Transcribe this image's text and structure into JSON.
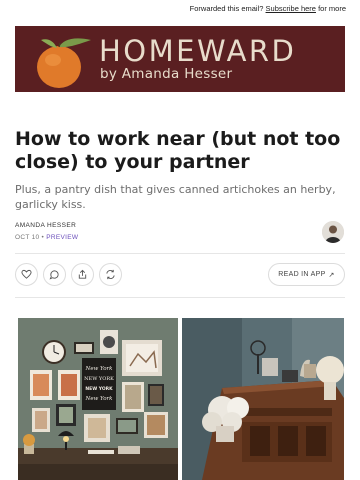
{
  "topbar": {
    "prefix": "Forwarded this email? ",
    "link_label": "Subscribe here",
    "suffix": " for more"
  },
  "banner": {
    "brand": "HOMEWARD",
    "byline": "by Amanda Hesser",
    "colors": {
      "background": "#5a1f21",
      "text": "#e8dccb",
      "orange": "#e07a2a",
      "leaf": "#7a9a4a"
    }
  },
  "post": {
    "title": "How to work near (but not too close) to your partner",
    "subtitle": "Plus, a pantry dish that gives canned artichokes an herby, garlicky kiss.",
    "author": "AMANDA HESSER",
    "date": "OCT 10",
    "separator": " • ",
    "preview_label": "PREVIEW"
  },
  "actions": {
    "icons": [
      "heart-icon",
      "comment-icon",
      "share-icon",
      "restack-icon"
    ],
    "read_in_app": "READ IN APP",
    "read_in_app_arrow": "↗"
  },
  "gallery": {
    "poster_lines": [
      "New York",
      "NEW YORK",
      "NEW YORK",
      "New York"
    ]
  }
}
